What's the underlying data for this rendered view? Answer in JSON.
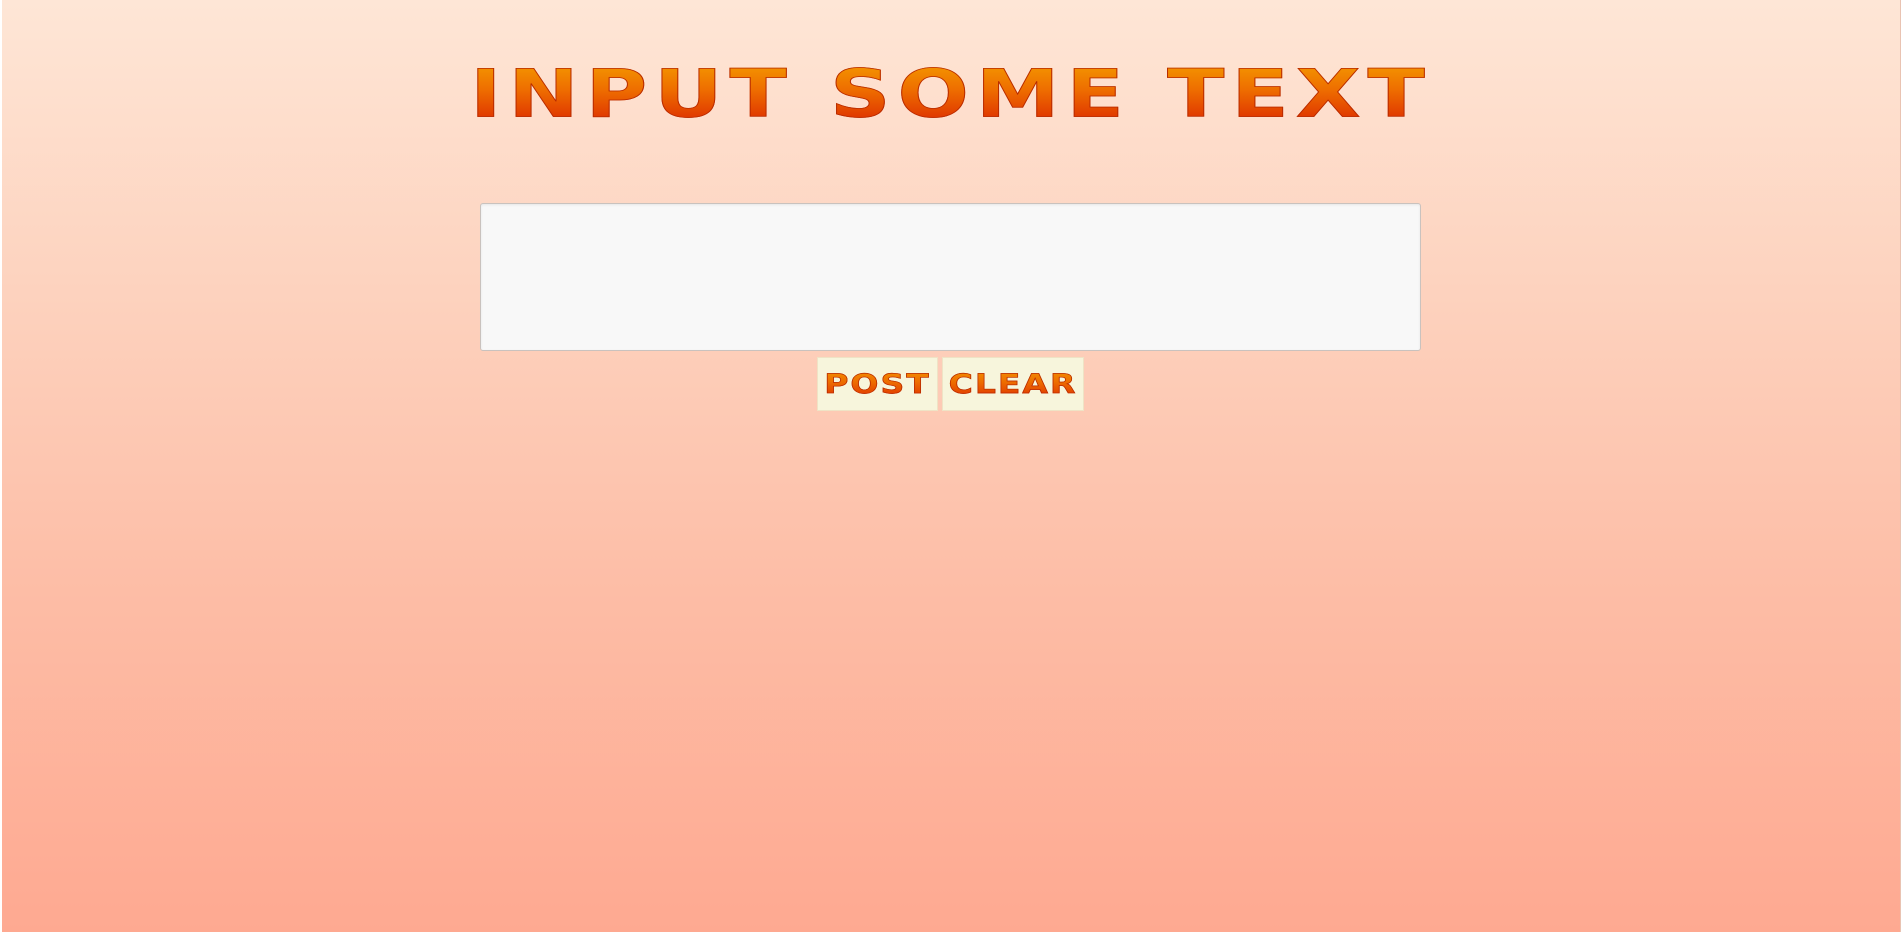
{
  "page": {
    "title": "INPUT SOME TEXT",
    "accent_colors": [
      "#f5a300",
      "#ee6d00",
      "#d81a00"
    ],
    "background_colors": [
      "#fee6d6",
      "#fea991"
    ]
  },
  "input": {
    "value": "",
    "placeholder": ""
  },
  "buttons": {
    "post_label": "POST",
    "clear_label": "CLEAR"
  }
}
